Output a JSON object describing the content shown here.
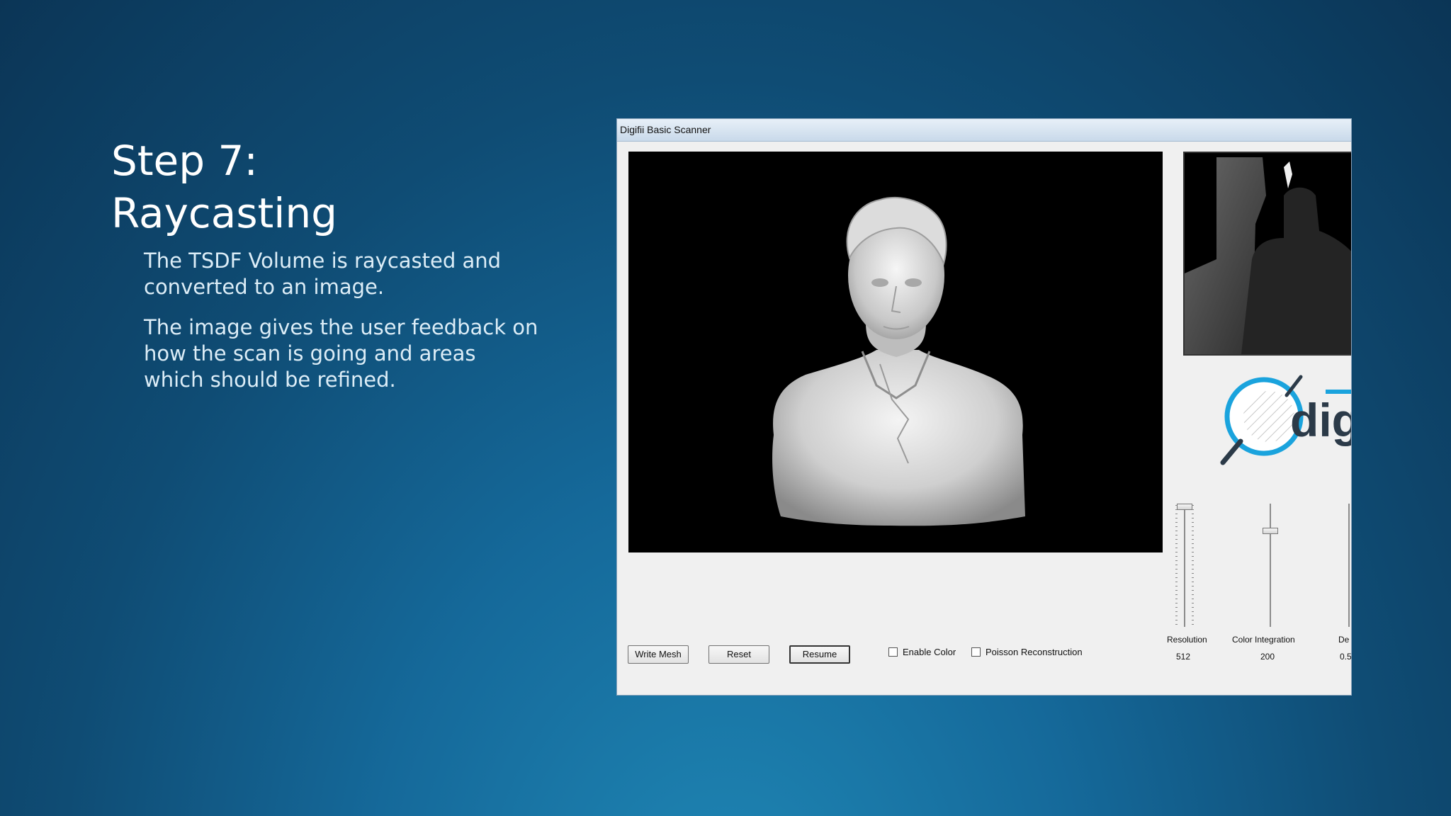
{
  "slide": {
    "title_line1": "Step 7:",
    "title_line2": "Raycasting",
    "bullet1": "The TSDF Volume is raycasted and converted to an image.",
    "bullet2": "The image gives the user feedback on how the scan is going and areas which should be refined."
  },
  "window": {
    "title": "Digifii Basic Scanner",
    "buttons": {
      "write_mesh": "Write Mesh",
      "reset": "Reset",
      "resume": "Resume"
    },
    "checkboxes": {
      "enable_color": {
        "label": "Enable Color",
        "checked": false
      },
      "poisson": {
        "label": "Poisson Reconstruction",
        "checked": false
      }
    },
    "sliders": {
      "resolution": {
        "label": "Resolution",
        "value": "512"
      },
      "color_integration": {
        "label": "Color Integration",
        "value": "200"
      },
      "depth": {
        "label": "De",
        "value": "0.5"
      }
    },
    "logo_text": "dig"
  },
  "colors": {
    "logo_blue": "#1aa3dd",
    "logo_dark": "#2b3a48"
  }
}
